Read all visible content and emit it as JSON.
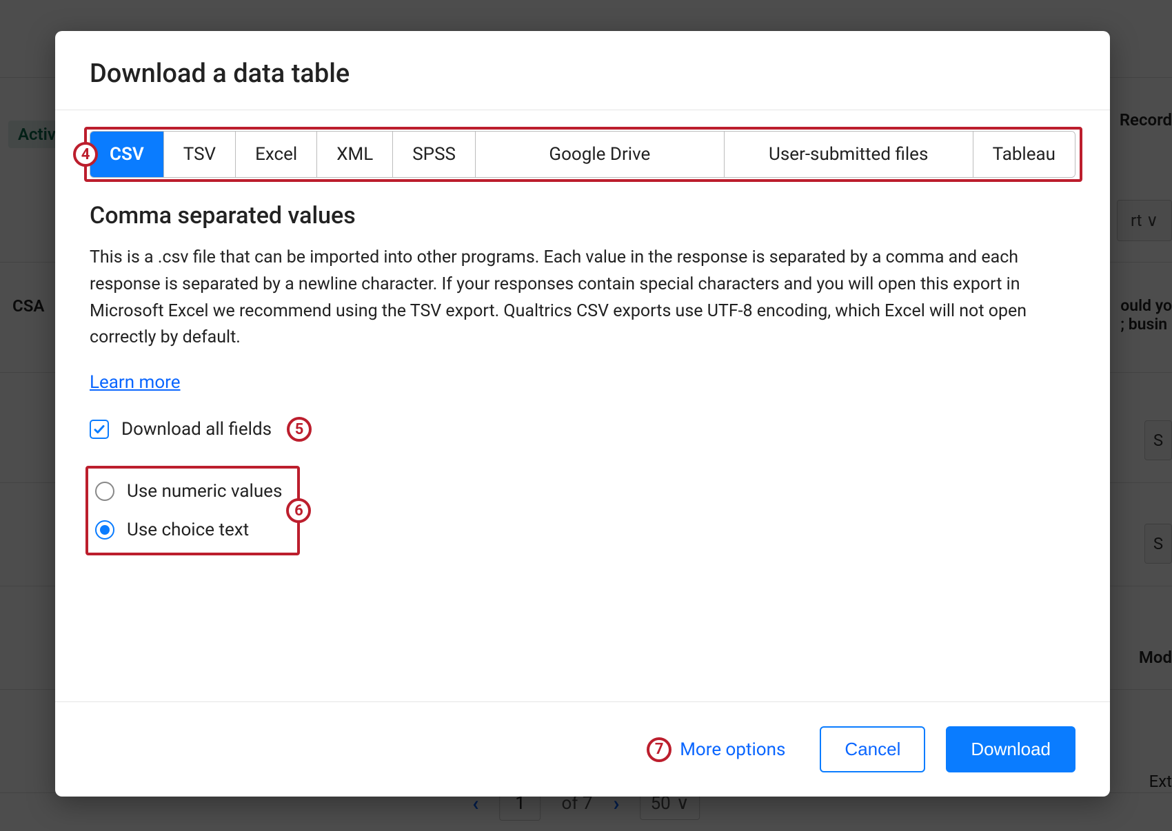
{
  "background": {
    "active_tag": "Activ",
    "record_label": "Record",
    "rt_btn": "rt ∨",
    "csa": "CSA",
    "right_text": "ould yo\n; busin",
    "s1": "S",
    "s2": "S",
    "mod": "Mod",
    "ext": "Ext",
    "pager": {
      "prev": "‹",
      "current": "1",
      "of": "of 7",
      "next": "›",
      "per_page": "50"
    }
  },
  "modal": {
    "title": "Download a data table",
    "tabs": [
      "CSV",
      "TSV",
      "Excel",
      "XML",
      "SPSS",
      "Google Drive",
      "User-submitted files",
      "Tableau"
    ],
    "active_tab": "CSV",
    "section_title": "Comma separated values",
    "description": "This is a .csv file that can be imported into other programs. Each value in the response is separated by a comma and each response is separated by a newline character. If your responses contain special characters and you will open this export in Microsoft Excel we recommend using the TSV export. Qualtrics CSV exports use UTF-8 encoding, which Excel will not open correctly by default.",
    "learn_more": "Learn more",
    "download_all_fields": "Download all fields",
    "radio_numeric": "Use numeric values",
    "radio_choice": "Use choice text",
    "more_options": "More options",
    "cancel": "Cancel",
    "download": "Download"
  },
  "annotations": {
    "a4": "4",
    "a5": "5",
    "a6": "6",
    "a7": "7"
  }
}
